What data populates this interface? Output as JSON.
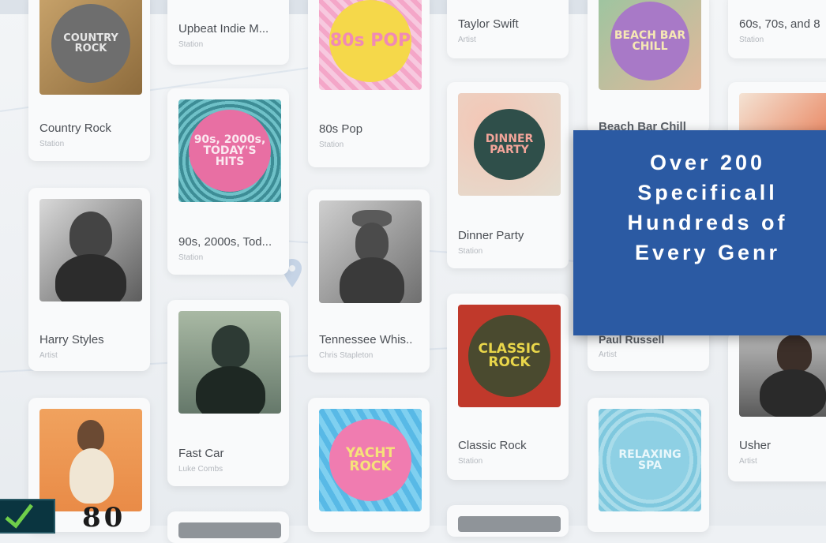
{
  "cards": {
    "country_rock": {
      "art": "COUNTRY ROCK",
      "title": "Country Rock",
      "sub": "Station"
    },
    "upbeat_indie": {
      "title": "Upbeat Indie M...",
      "sub": "Station"
    },
    "eighties_pop_art": "80s POP",
    "taylor_swift": {
      "title": "Taylor Swift",
      "sub": "Artist"
    },
    "beach_bar": {
      "art": "BEACH BAR CHILL",
      "title": "Beach Bar Chill"
    },
    "sixties": {
      "title": "60s, 70s, and 8",
      "sub": "Station"
    },
    "eighties_pop": {
      "title": "80s Pop",
      "sub": "Station"
    },
    "nineties": {
      "art": "90s, 2000s, TODAY'S HITS",
      "title": "90s, 2000s, Tod...",
      "sub": "Station"
    },
    "dinner_party": {
      "art": "DINNER PARTY",
      "title": "Dinner Party",
      "sub": "Station"
    },
    "harry_styles": {
      "title": "Harry Styles",
      "sub": "Artist"
    },
    "tennessee": {
      "title": "Tennessee Whis..",
      "sub": "Chris Stapleton"
    },
    "paul_russell": {
      "title": "Paul Russell",
      "sub": "Artist"
    },
    "fast_car": {
      "title": "Fast Car",
      "sub": "Luke Combs"
    },
    "classic_rock": {
      "art": "CLASSIC ROCK",
      "title": "Classic Rock",
      "sub": "Station"
    },
    "usher": {
      "title": "Usher",
      "sub": "Artist"
    },
    "yacht_rock": {
      "art": "YACHT ROCK"
    },
    "relaxing_spa": {
      "art": "RELAXING SPA"
    }
  },
  "overlay": {
    "line1": "Over 200",
    "line2": "Specificall",
    "line3": "Hundreds of",
    "line4": "Every Genr"
  },
  "logo_text": "80"
}
